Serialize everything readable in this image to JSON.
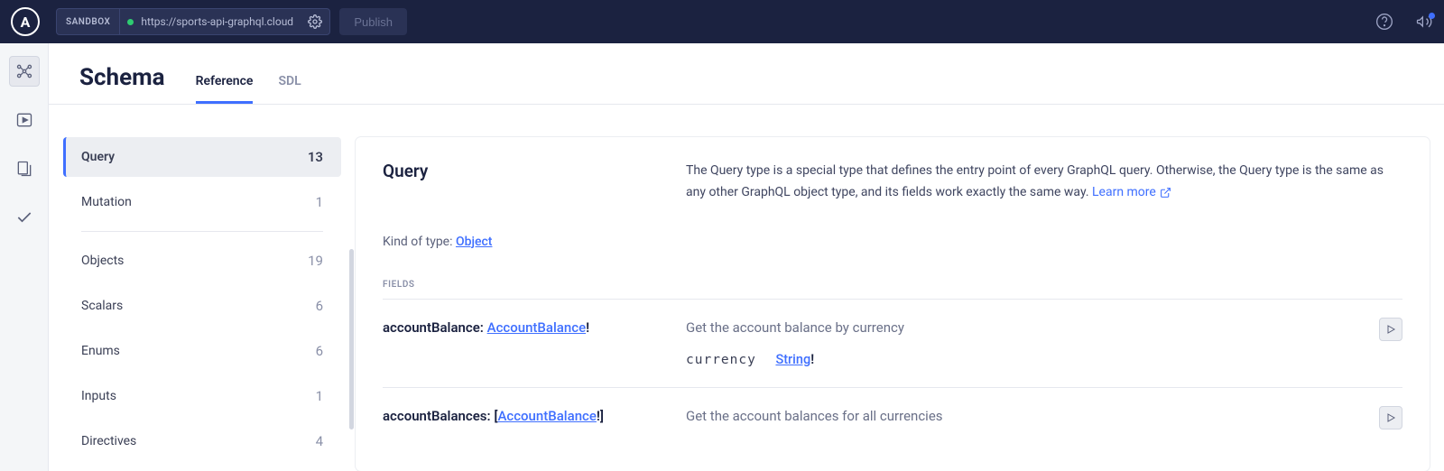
{
  "topbar": {
    "logo_letter": "A",
    "sandbox_label": "SANDBOX",
    "url": "https://sports-api-graphql.cloudbet.c",
    "publish_label": "Publish"
  },
  "header": {
    "title": "Schema",
    "tabs": [
      {
        "label": "Reference",
        "active": true
      },
      {
        "label": "SDL",
        "active": false
      }
    ]
  },
  "sidebar": {
    "items": [
      {
        "label": "Query",
        "count": "13",
        "active": true
      },
      {
        "label": "Mutation",
        "count": "1"
      }
    ],
    "groups": [
      {
        "label": "Objects",
        "count": "19"
      },
      {
        "label": "Scalars",
        "count": "6"
      },
      {
        "label": "Enums",
        "count": "6"
      },
      {
        "label": "Inputs",
        "count": "1"
      },
      {
        "label": "Directives",
        "count": "4"
      }
    ]
  },
  "panel": {
    "type_name": "Query",
    "description": "The Query type is a special type that defines the entry point of every GraphQL query. Otherwise, the Query type is the same as any other GraphQL object type, and its fields work exactly the same way. ",
    "learn_more": "Learn more",
    "kind_label": "Kind of type: ",
    "kind_value": "Object",
    "fields_label": "FIELDS",
    "fields": [
      {
        "name": "accountBalance",
        "return_prefix": "",
        "return_type": "AccountBalance",
        "return_suffix": "!",
        "desc": "Get the account balance by currency",
        "arg_name": "currency",
        "arg_type": "String",
        "arg_suffix": "!"
      },
      {
        "name": "accountBalances",
        "return_prefix": "[",
        "return_type": "AccountBalance",
        "return_suffix": "!]",
        "desc": "Get the account balances for all currencies"
      }
    ]
  }
}
